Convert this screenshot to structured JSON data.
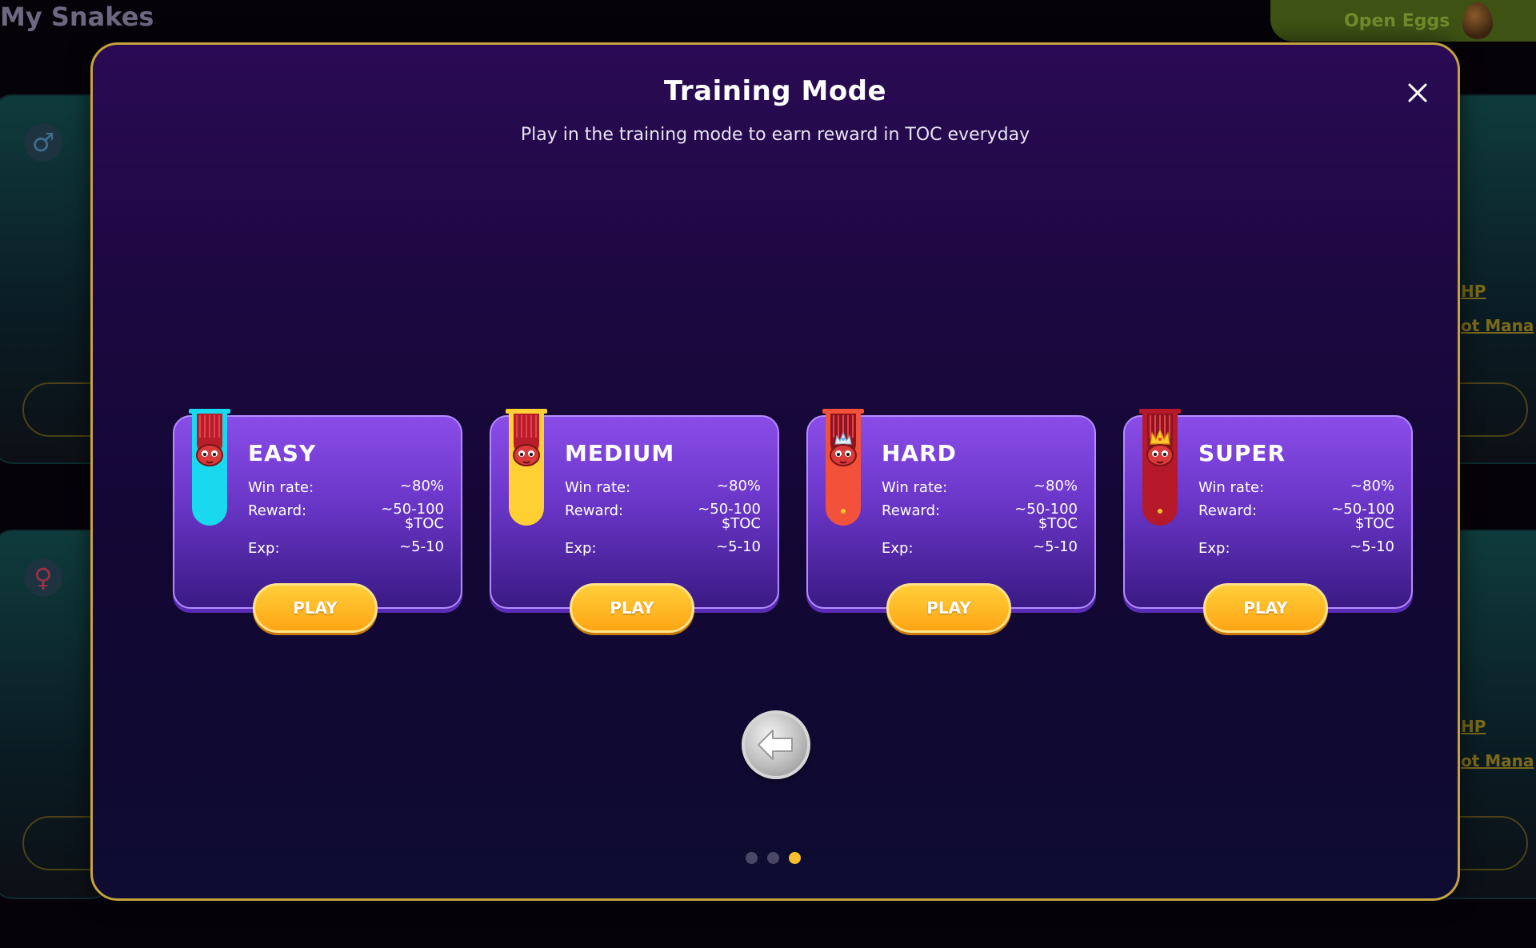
{
  "background": {
    "page_title": "My Snakes",
    "open_eggs_label": "Open Eggs",
    "stat_link_hp": "HP",
    "stat_link_mana": "ot Mana"
  },
  "modal": {
    "title": "Training Mode",
    "subtitle": "Play in the training mode to earn reward in TOC everyday",
    "modes": [
      {
        "name": "EASY",
        "win_rate_label": "Win rate:",
        "win_rate": "~80%",
        "reward_label": "Reward:",
        "reward_line1": "~50-100",
        "reward_line2": "$TOC",
        "exp_label": "Exp:",
        "exp": "~5-10",
        "play_label": "PLAY",
        "banner_color": "#19d9ee",
        "banner_icon": "snake-head"
      },
      {
        "name": "MEDIUM",
        "win_rate_label": "Win rate:",
        "win_rate": "~80%",
        "reward_label": "Reward:",
        "reward_line1": "~50-100",
        "reward_line2": "$TOC",
        "exp_label": "Exp:",
        "exp": "~5-10",
        "play_label": "PLAY",
        "banner_color": "#ffd034",
        "banner_icon": "snake-head"
      },
      {
        "name": "HARD",
        "win_rate_label": "Win rate:",
        "win_rate": "~80%",
        "reward_label": "Reward:",
        "reward_line1": "~50-100",
        "reward_line2": "$TOC",
        "exp_label": "Exp:",
        "exp": "~5-10",
        "play_label": "PLAY",
        "banner_color": "#f2513a",
        "banner_icon": "snake-silver-crown"
      },
      {
        "name": "SUPER",
        "win_rate_label": "Win rate:",
        "win_rate": "~80%",
        "reward_label": "Reward:",
        "reward_line1": "~50-100",
        "reward_line2": "$TOC",
        "exp_label": "Exp:",
        "exp": "~5-10",
        "play_label": "PLAY",
        "banner_color": "#b5192a",
        "banner_icon": "snake-gold-crown"
      }
    ],
    "pagination": {
      "total": 3,
      "active": 3
    }
  },
  "colors": {
    "accent_gold": "#f6c12c",
    "modal_border": "#c6a23e",
    "card_purple": "#7b43dc"
  }
}
